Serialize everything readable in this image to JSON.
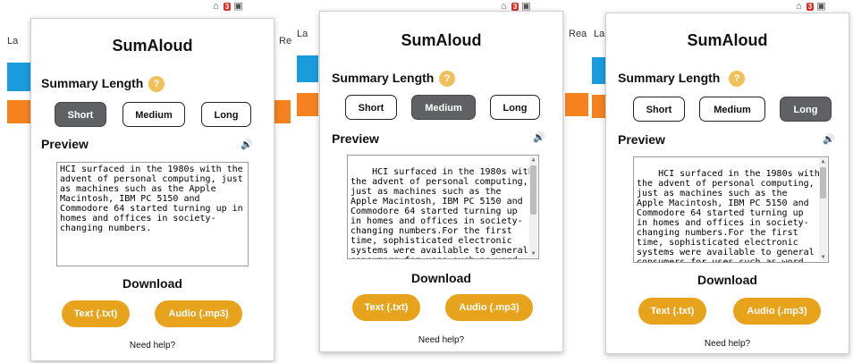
{
  "app": {
    "title": "SumAloud",
    "summary_length_label": "Summary Length",
    "help_badge": "?",
    "preview_label": "Preview",
    "speaker_icon": "speaker-icon",
    "download_label": "Download",
    "text_btn": "Text (.txt)",
    "audio_btn": "Audio (.mp3)",
    "need_help": "Need help?",
    "colors": {
      "accent": "#e8a31c",
      "active": "#5f6164",
      "help": "#f0c05a",
      "nav_blue": "#1a9bdc",
      "nav_orange": "#f5821f"
    }
  },
  "background": {
    "bg1": "Lа",
    "bg1_right": "Re",
    "bg2": "La",
    "bg2_right": "Rea",
    "bg3": "La",
    "badge": "3"
  },
  "panels": [
    {
      "length_options": [
        "Short",
        "Medium",
        "Long"
      ],
      "selected": "Short",
      "preview_text": "HCI surfaced in the 1980s with the\nadvent of personal computing, just\nas machines such as the Apple\nMacintosh, IBM PC 5150 and\nCommodore 64 started turning up in\nhomes and offices in society-\nchanging numbers."
    },
    {
      "length_options": [
        "Short",
        "Medium",
        "Long"
      ],
      "selected": "Medium",
      "preview_text": "HCI surfaced in the 1980s with\nthe advent of personal computing,\njust as machines such as the\nApple Macintosh, IBM PC 5150 and\nCommodore 64 started turning up\nin homes and offices in society-\nchanging numbers.For the first\ntime, sophisticated electronic\nsystems were available to general\nconsumers for uses such as word"
    },
    {
      "length_options": [
        "Short",
        "Medium",
        "Long"
      ],
      "selected": "Long",
      "preview_text": "HCI surfaced in the 1980s with\nthe advent of personal computing,\njust as machines such as the\nApple Macintosh, IBM PC 5150 and\nCommodore 64 started turning up\nin homes and offices in society-\nchanging numbers.For the first\ntime, sophisticated electronic\nsystems were available to general\nconsumers for uses such as word"
    }
  ]
}
